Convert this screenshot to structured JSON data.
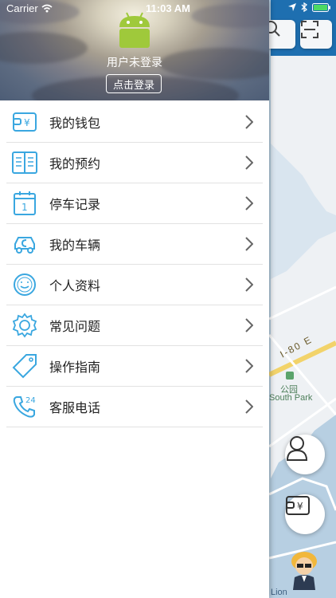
{
  "status_bar": {
    "carrier": "Carrier",
    "time": "11:03 AM"
  },
  "profile": {
    "user_status": "用户未登录",
    "login_button": "点击登录"
  },
  "menu": [
    {
      "label": "我的钱包",
      "icon": "wallet-icon"
    },
    {
      "label": "我的预约",
      "icon": "book-icon"
    },
    {
      "label": "停车记录",
      "icon": "calendar-icon"
    },
    {
      "label": "我的车辆",
      "icon": "car-icon"
    },
    {
      "label": "个人资料",
      "icon": "smiley-icon"
    },
    {
      "label": "常见问题",
      "icon": "gear-icon"
    },
    {
      "label": "操作指南",
      "icon": "tag-icon"
    },
    {
      "label": "客服电话",
      "icon": "phone-24-icon"
    }
  ],
  "map": {
    "road_label": "I-80 E",
    "park_label_cn": "公园",
    "park_label_en": "South Park",
    "bottom_label": "Lion"
  },
  "colors": {
    "accent": "#3aa7e0",
    "map_water": "#b7cfe2",
    "map_land": "#eef1f4"
  }
}
